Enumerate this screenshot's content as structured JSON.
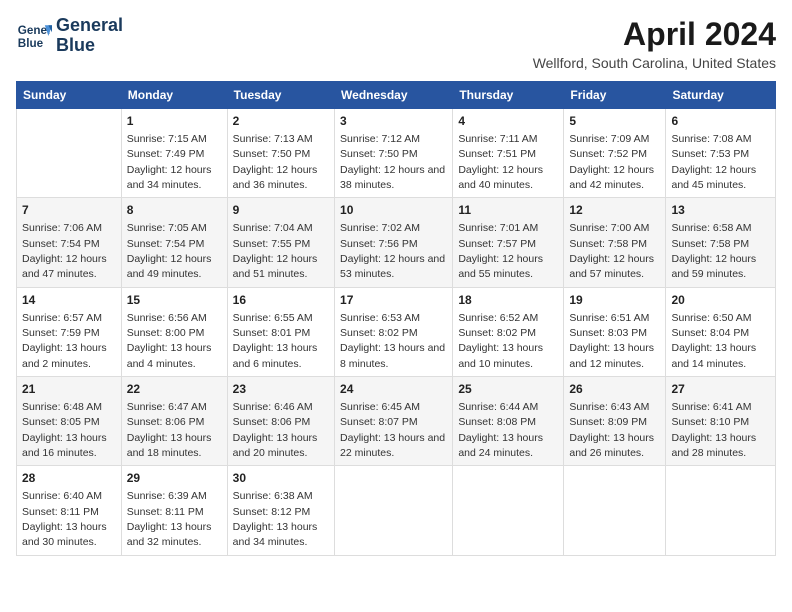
{
  "header": {
    "logo_line1": "General",
    "logo_line2": "Blue",
    "title": "April 2024",
    "subtitle": "Wellford, South Carolina, United States"
  },
  "days_of_week": [
    "Sunday",
    "Monday",
    "Tuesday",
    "Wednesday",
    "Thursday",
    "Friday",
    "Saturday"
  ],
  "weeks": [
    [
      {
        "day": "",
        "sunrise": "",
        "sunset": "",
        "daylight": ""
      },
      {
        "day": "1",
        "sunrise": "Sunrise: 7:15 AM",
        "sunset": "Sunset: 7:49 PM",
        "daylight": "Daylight: 12 hours and 34 minutes."
      },
      {
        "day": "2",
        "sunrise": "Sunrise: 7:13 AM",
        "sunset": "Sunset: 7:50 PM",
        "daylight": "Daylight: 12 hours and 36 minutes."
      },
      {
        "day": "3",
        "sunrise": "Sunrise: 7:12 AM",
        "sunset": "Sunset: 7:50 PM",
        "daylight": "Daylight: 12 hours and 38 minutes."
      },
      {
        "day": "4",
        "sunrise": "Sunrise: 7:11 AM",
        "sunset": "Sunset: 7:51 PM",
        "daylight": "Daylight: 12 hours and 40 minutes."
      },
      {
        "day": "5",
        "sunrise": "Sunrise: 7:09 AM",
        "sunset": "Sunset: 7:52 PM",
        "daylight": "Daylight: 12 hours and 42 minutes."
      },
      {
        "day": "6",
        "sunrise": "Sunrise: 7:08 AM",
        "sunset": "Sunset: 7:53 PM",
        "daylight": "Daylight: 12 hours and 45 minutes."
      }
    ],
    [
      {
        "day": "7",
        "sunrise": "Sunrise: 7:06 AM",
        "sunset": "Sunset: 7:54 PM",
        "daylight": "Daylight: 12 hours and 47 minutes."
      },
      {
        "day": "8",
        "sunrise": "Sunrise: 7:05 AM",
        "sunset": "Sunset: 7:54 PM",
        "daylight": "Daylight: 12 hours and 49 minutes."
      },
      {
        "day": "9",
        "sunrise": "Sunrise: 7:04 AM",
        "sunset": "Sunset: 7:55 PM",
        "daylight": "Daylight: 12 hours and 51 minutes."
      },
      {
        "day": "10",
        "sunrise": "Sunrise: 7:02 AM",
        "sunset": "Sunset: 7:56 PM",
        "daylight": "Daylight: 12 hours and 53 minutes."
      },
      {
        "day": "11",
        "sunrise": "Sunrise: 7:01 AM",
        "sunset": "Sunset: 7:57 PM",
        "daylight": "Daylight: 12 hours and 55 minutes."
      },
      {
        "day": "12",
        "sunrise": "Sunrise: 7:00 AM",
        "sunset": "Sunset: 7:58 PM",
        "daylight": "Daylight: 12 hours and 57 minutes."
      },
      {
        "day": "13",
        "sunrise": "Sunrise: 6:58 AM",
        "sunset": "Sunset: 7:58 PM",
        "daylight": "Daylight: 12 hours and 59 minutes."
      }
    ],
    [
      {
        "day": "14",
        "sunrise": "Sunrise: 6:57 AM",
        "sunset": "Sunset: 7:59 PM",
        "daylight": "Daylight: 13 hours and 2 minutes."
      },
      {
        "day": "15",
        "sunrise": "Sunrise: 6:56 AM",
        "sunset": "Sunset: 8:00 PM",
        "daylight": "Daylight: 13 hours and 4 minutes."
      },
      {
        "day": "16",
        "sunrise": "Sunrise: 6:55 AM",
        "sunset": "Sunset: 8:01 PM",
        "daylight": "Daylight: 13 hours and 6 minutes."
      },
      {
        "day": "17",
        "sunrise": "Sunrise: 6:53 AM",
        "sunset": "Sunset: 8:02 PM",
        "daylight": "Daylight: 13 hours and 8 minutes."
      },
      {
        "day": "18",
        "sunrise": "Sunrise: 6:52 AM",
        "sunset": "Sunset: 8:02 PM",
        "daylight": "Daylight: 13 hours and 10 minutes."
      },
      {
        "day": "19",
        "sunrise": "Sunrise: 6:51 AM",
        "sunset": "Sunset: 8:03 PM",
        "daylight": "Daylight: 13 hours and 12 minutes."
      },
      {
        "day": "20",
        "sunrise": "Sunrise: 6:50 AM",
        "sunset": "Sunset: 8:04 PM",
        "daylight": "Daylight: 13 hours and 14 minutes."
      }
    ],
    [
      {
        "day": "21",
        "sunrise": "Sunrise: 6:48 AM",
        "sunset": "Sunset: 8:05 PM",
        "daylight": "Daylight: 13 hours and 16 minutes."
      },
      {
        "day": "22",
        "sunrise": "Sunrise: 6:47 AM",
        "sunset": "Sunset: 8:06 PM",
        "daylight": "Daylight: 13 hours and 18 minutes."
      },
      {
        "day": "23",
        "sunrise": "Sunrise: 6:46 AM",
        "sunset": "Sunset: 8:06 PM",
        "daylight": "Daylight: 13 hours and 20 minutes."
      },
      {
        "day": "24",
        "sunrise": "Sunrise: 6:45 AM",
        "sunset": "Sunset: 8:07 PM",
        "daylight": "Daylight: 13 hours and 22 minutes."
      },
      {
        "day": "25",
        "sunrise": "Sunrise: 6:44 AM",
        "sunset": "Sunset: 8:08 PM",
        "daylight": "Daylight: 13 hours and 24 minutes."
      },
      {
        "day": "26",
        "sunrise": "Sunrise: 6:43 AM",
        "sunset": "Sunset: 8:09 PM",
        "daylight": "Daylight: 13 hours and 26 minutes."
      },
      {
        "day": "27",
        "sunrise": "Sunrise: 6:41 AM",
        "sunset": "Sunset: 8:10 PM",
        "daylight": "Daylight: 13 hours and 28 minutes."
      }
    ],
    [
      {
        "day": "28",
        "sunrise": "Sunrise: 6:40 AM",
        "sunset": "Sunset: 8:11 PM",
        "daylight": "Daylight: 13 hours and 30 minutes."
      },
      {
        "day": "29",
        "sunrise": "Sunrise: 6:39 AM",
        "sunset": "Sunset: 8:11 PM",
        "daylight": "Daylight: 13 hours and 32 minutes."
      },
      {
        "day": "30",
        "sunrise": "Sunrise: 6:38 AM",
        "sunset": "Sunset: 8:12 PM",
        "daylight": "Daylight: 13 hours and 34 minutes."
      },
      {
        "day": "",
        "sunrise": "",
        "sunset": "",
        "daylight": ""
      },
      {
        "day": "",
        "sunrise": "",
        "sunset": "",
        "daylight": ""
      },
      {
        "day": "",
        "sunrise": "",
        "sunset": "",
        "daylight": ""
      },
      {
        "day": "",
        "sunrise": "",
        "sunset": "",
        "daylight": ""
      }
    ]
  ]
}
